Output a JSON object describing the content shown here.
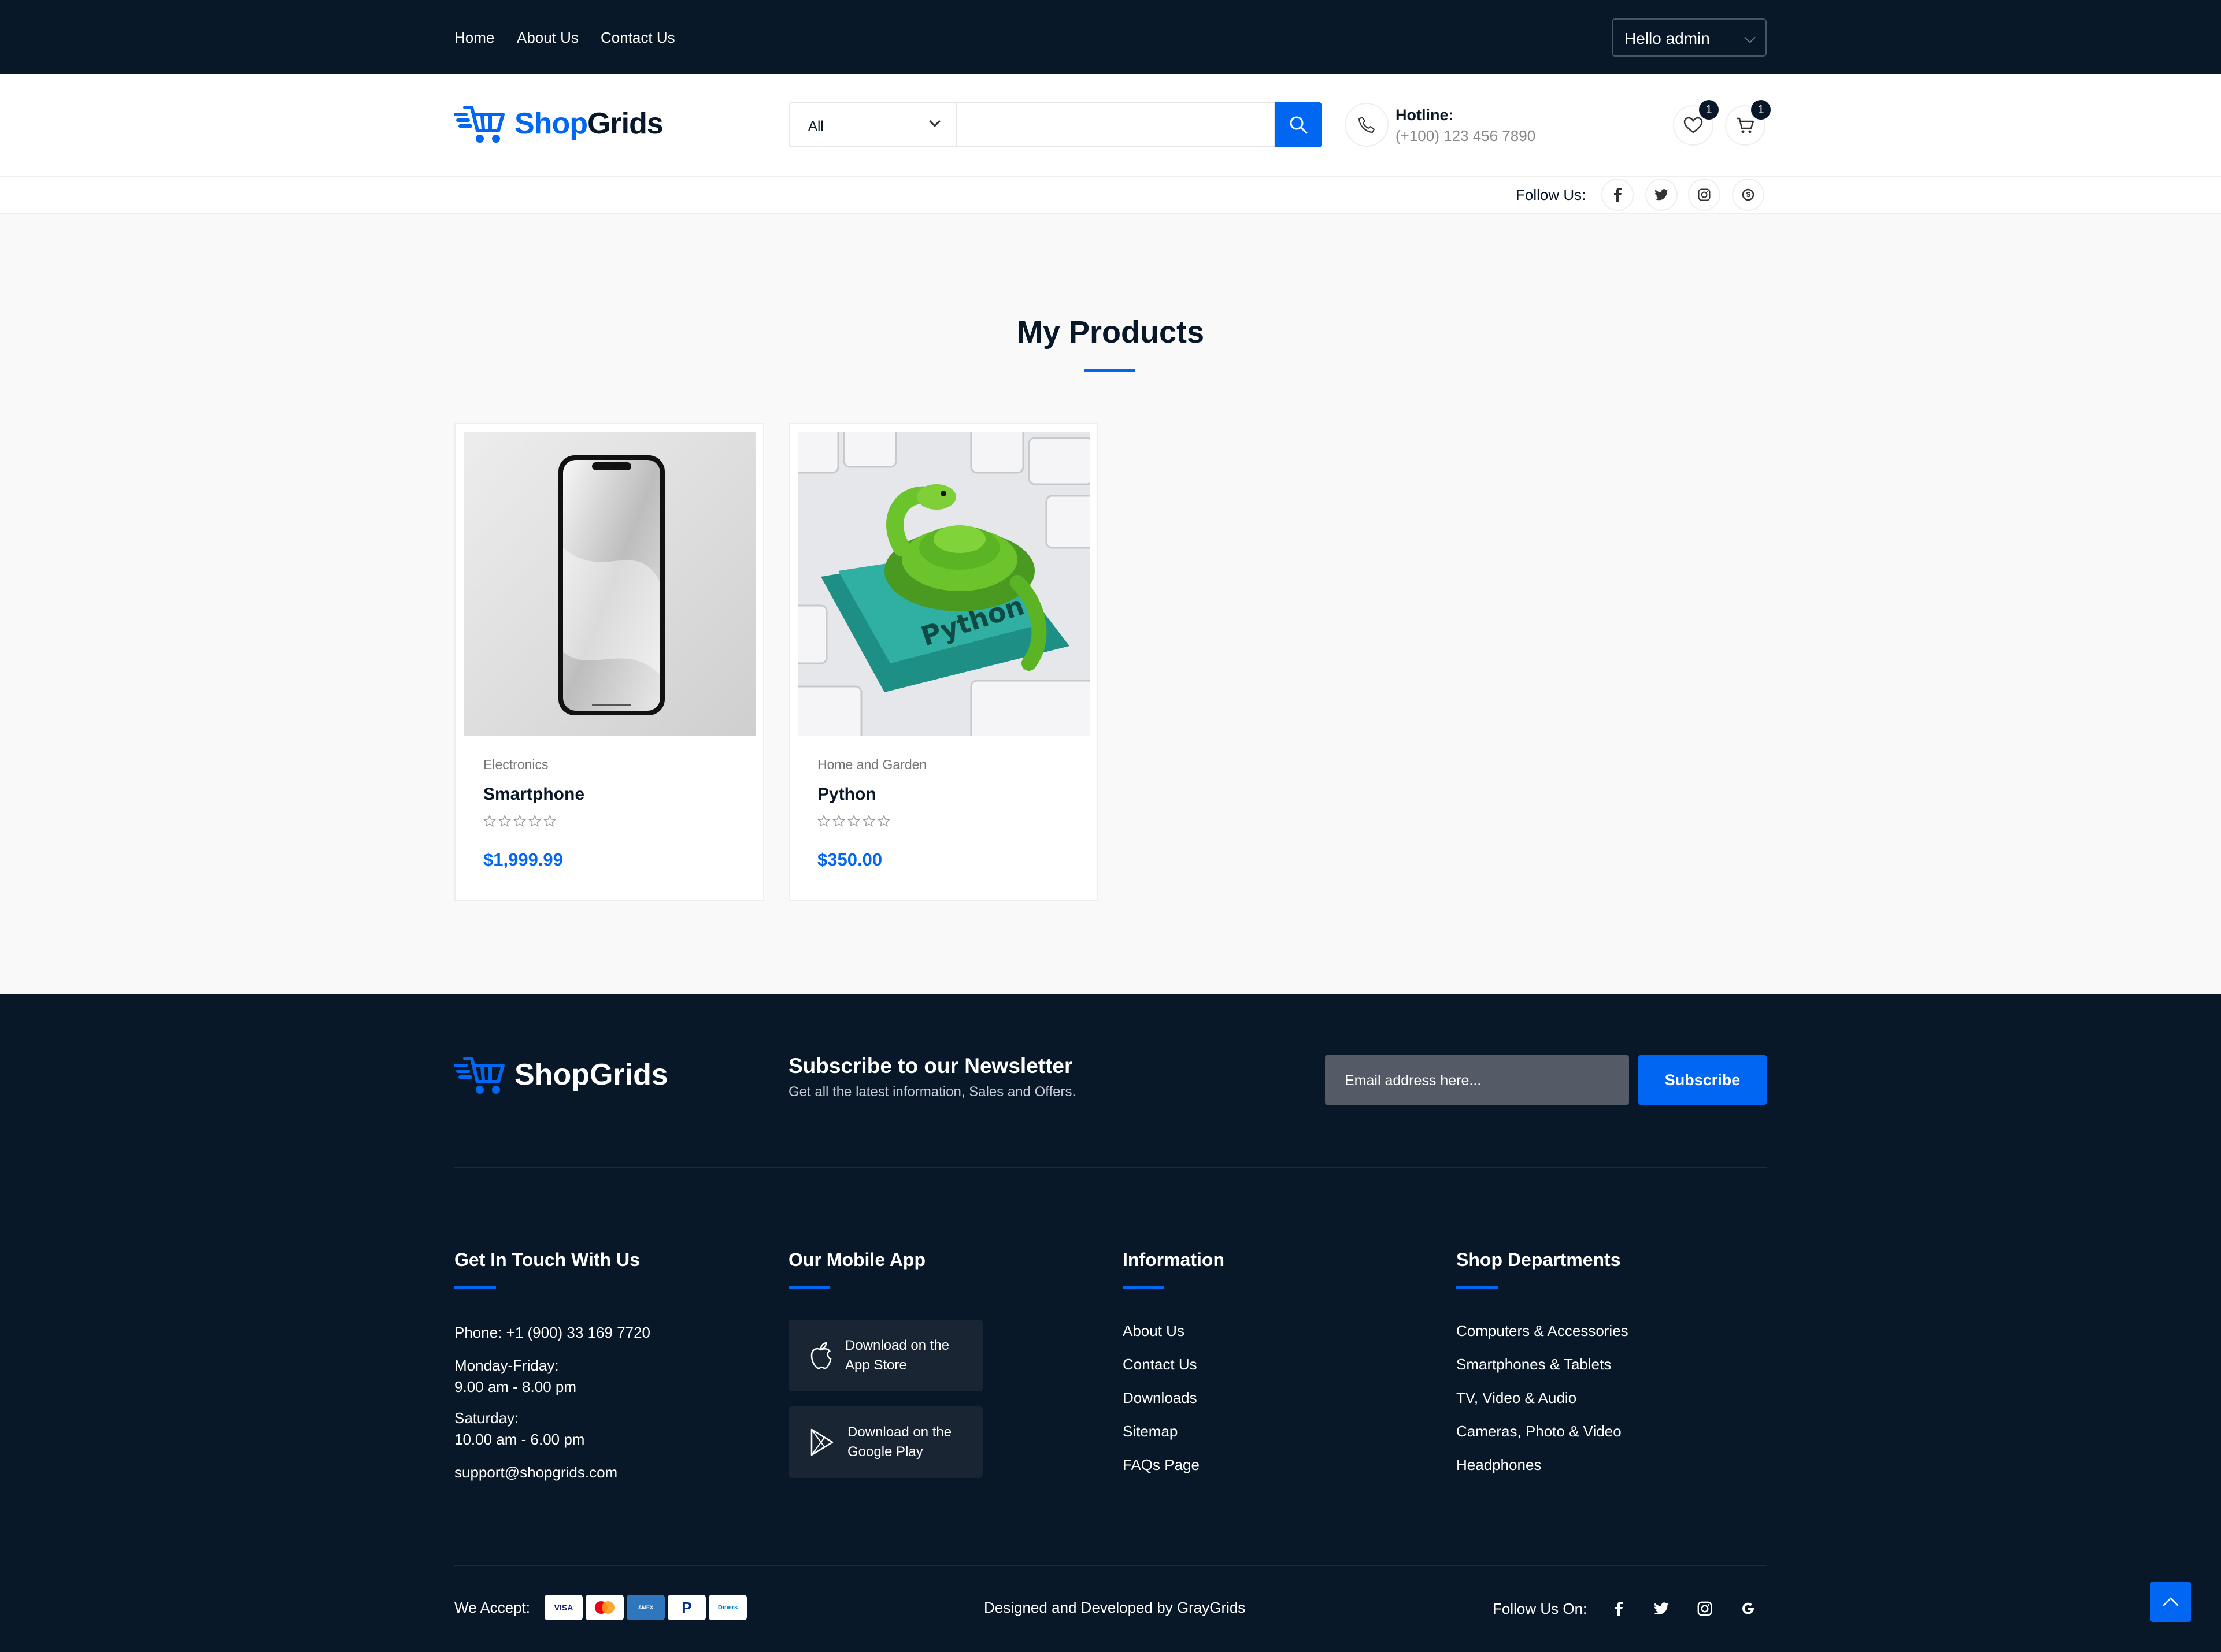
{
  "topbar": {
    "nav": [
      "Home",
      "About Us",
      "Contact Us"
    ],
    "user_select": "Hello admin"
  },
  "header": {
    "logo_prefix": "Shop",
    "logo_suffix": "Grids",
    "search_category": "All",
    "search_placeholder": "",
    "hotline_label": "Hotline:",
    "hotline_number": "(+100) 123 456 7890",
    "wishlist_count": "1",
    "cart_count": "1",
    "follow_label": "Follow Us:",
    "social_icons": [
      "facebook-icon",
      "twitter-icon",
      "instagram-icon",
      "skype-icon"
    ]
  },
  "products": {
    "title": "My Products",
    "items": [
      {
        "category": "Electronics",
        "name": "Smartphone",
        "price": "$1,999.99",
        "rating": 0,
        "image": "smartphone-image"
      },
      {
        "category": "Home and Garden",
        "name": "Python",
        "price": "$350.00",
        "rating": 0,
        "image": "python-image"
      }
    ]
  },
  "footer": {
    "logo_text": "ShopGrids",
    "newsletter": {
      "title": "Subscribe to our Newsletter",
      "subtitle": "Get all the latest information, Sales and Offers.",
      "placeholder": "Email address here...",
      "button": "Subscribe"
    },
    "contact": {
      "heading": "Get In Touch With Us",
      "phone": "Phone: +1 (900) 33 169 7720",
      "weekday_label": "Monday-Friday:",
      "weekday_hours": "9.00 am - 8.00 pm",
      "saturday_label": "Saturday:",
      "saturday_hours": "10.00 am - 6.00 pm",
      "email": "support@shopgrids.com"
    },
    "app": {
      "heading": "Our Mobile App",
      "appstore_line1": "Download on the",
      "appstore_line2": "App Store",
      "googleplay_line1": "Download on the",
      "googleplay_line2": "Google Play"
    },
    "information": {
      "heading": "Information",
      "links": [
        "About Us",
        "Contact Us",
        "Downloads",
        "Sitemap",
        "FAQs Page"
      ]
    },
    "departments": {
      "heading": "Shop Departments",
      "links": [
        "Computers & Accessories",
        "Smartphones & Tablets",
        "TV, Video & Audio",
        "Cameras, Photo & Video",
        "Headphones"
      ]
    },
    "bottom": {
      "we_accept": "We Accept:",
      "payments": [
        "VISA",
        "MC",
        "AMEX",
        "PayPal",
        "Diners"
      ],
      "credit": "Designed and Developed by GrayGrids",
      "follow_label": "Follow Us On:"
    }
  },
  "colors": {
    "navy": "#081828",
    "accent": "#0167f3"
  }
}
